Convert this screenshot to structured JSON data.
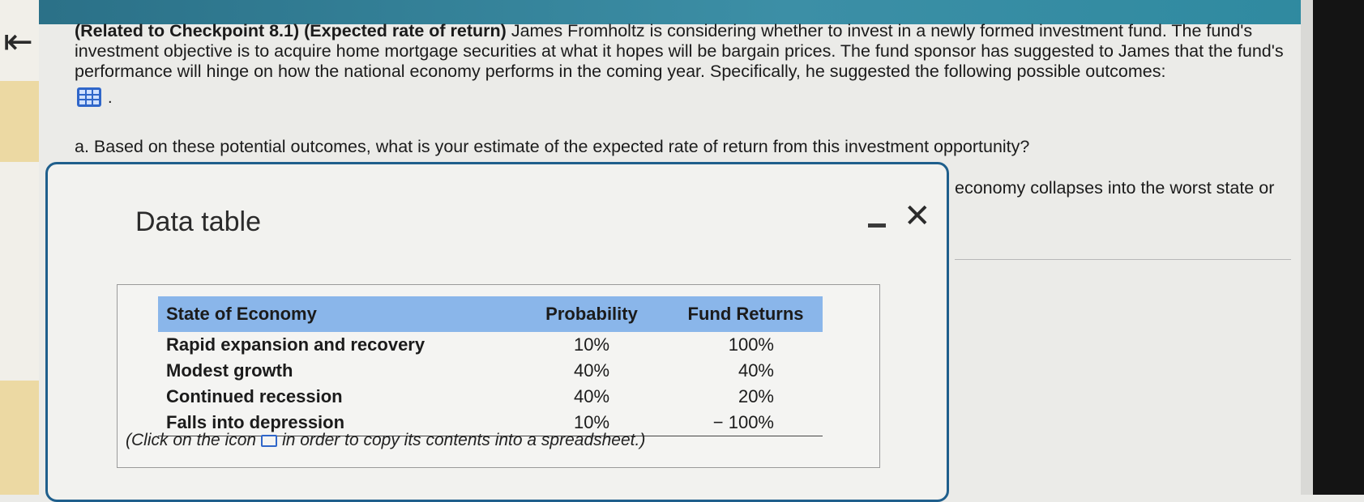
{
  "question": {
    "ref": "(Related to Checkpoint 8.1)",
    "topic": "(Expected rate of return)",
    "body": "James Fromholtz is considering whether to invest in a newly formed investment fund. The fund's investment objective is to acquire home mortgage securities at what it hopes will be bargain prices. The fund sponsor has suggested to James that the fund's performance will hinge on how the national economy performs in the coming year. Specifically, he suggested the following possible outcomes:"
  },
  "part_a": "a. Based on these potential outcomes, what is your estimate of the expected rate of return from this investment opportunity?",
  "tail_text": "economy collapses into the worst state or",
  "modal": {
    "title": "Data table",
    "headers": [
      "State of Economy",
      "Probability",
      "Fund Returns"
    ],
    "rows": [
      {
        "state": "Rapid expansion and recovery",
        "prob": "10%",
        "ret": "100%"
      },
      {
        "state": "Modest growth",
        "prob": "40%",
        "ret": "40%"
      },
      {
        "state": "Continued recession",
        "prob": "40%",
        "ret": "20%"
      },
      {
        "state": "Falls into depression",
        "prob": "10%",
        "ret": "− 100%"
      }
    ],
    "caption_before": "(Click on the icon",
    "caption_after": "in order to copy its contents into a spreadsheet.)"
  },
  "colors": {
    "header_bg": "#8ab6ea",
    "modal_border": "#1f5f8c",
    "icon_blue": "#2f66c9"
  }
}
